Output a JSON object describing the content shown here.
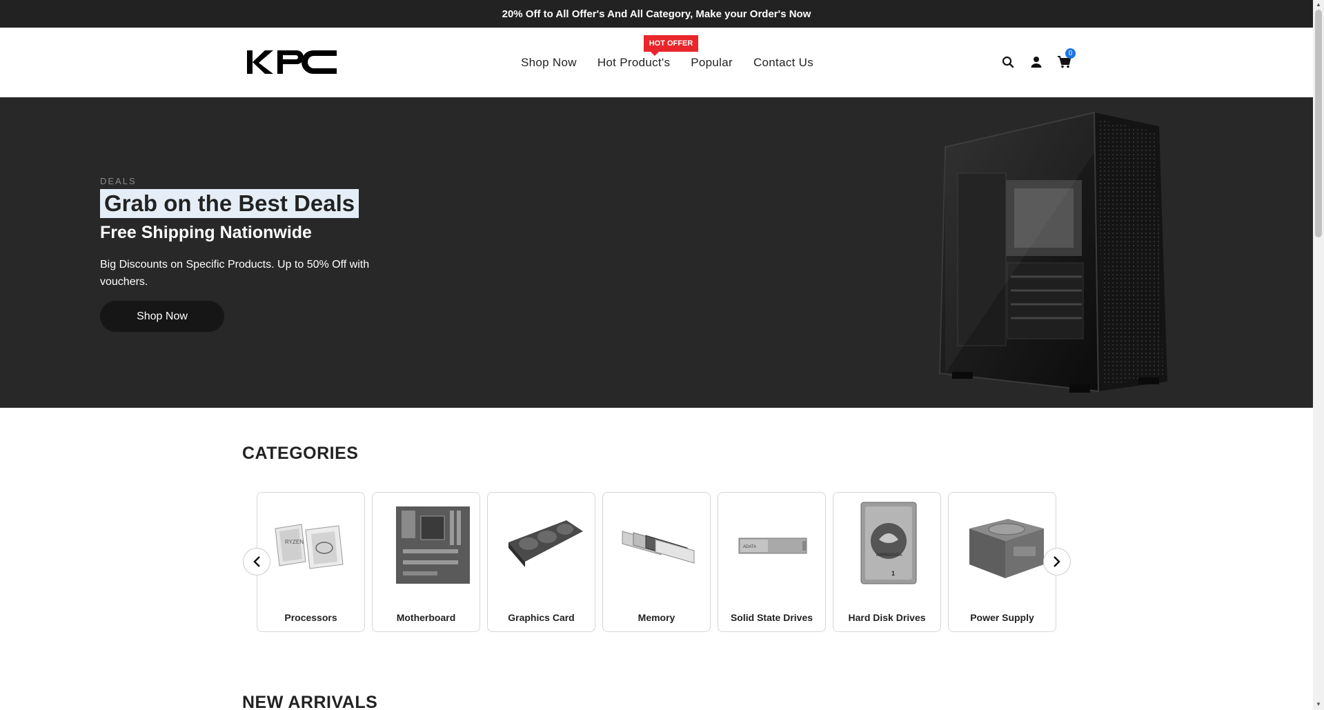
{
  "announcement": "20% Off to All Offer's And All Category, Make your Order's Now",
  "nav": {
    "items": [
      {
        "label": "Shop Now"
      },
      {
        "label": "Hot Product's"
      },
      {
        "label": "Popular"
      },
      {
        "label": "Contact Us"
      }
    ],
    "hot_badge": "HOT OFFER"
  },
  "header": {
    "logo_icon": "kpc-logo",
    "cart_count": "0",
    "icons": [
      "search-icon",
      "user-icon",
      "cart-icon"
    ]
  },
  "hero": {
    "overline": "DEALS",
    "title": "Grab on the Best Deals",
    "subtitle": "Free Shipping Nationwide",
    "text": "Big Discounts on Specific Products. Up to 50% Off with vouchers.",
    "button": "Shop Now"
  },
  "categories": {
    "title": "CATEGORIES",
    "items": [
      {
        "label": "Processors"
      },
      {
        "label": "Motherboard"
      },
      {
        "label": "Graphics Card"
      },
      {
        "label": "Memory"
      },
      {
        "label": "Solid State Drives"
      },
      {
        "label": "Hard Disk Drives"
      },
      {
        "label": "Power Supply"
      }
    ]
  },
  "new_arrivals": {
    "title": "NEW ARRIVALS"
  },
  "colors": {
    "bar": "#222222",
    "hero_bg": "#282828",
    "badge": "#e8262b",
    "cart_badge": "#1a73e8"
  }
}
